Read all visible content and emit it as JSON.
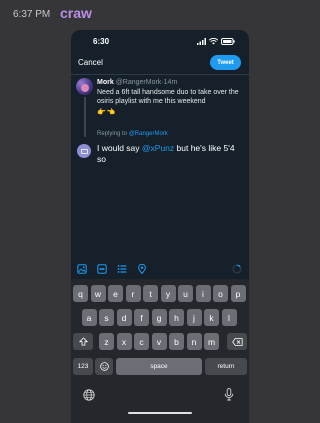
{
  "chat": {
    "time": "6:37 PM",
    "username": "craw"
  },
  "status_bar": {
    "time": "6:30"
  },
  "compose": {
    "cancel_label": "Cancel",
    "tweet_label": "Tweet"
  },
  "original_tweet": {
    "name": "Mork",
    "handle": "@RangerMork",
    "age": "14m",
    "text": "Need a 6ft tall handsome duo to take over the osiris playlist with me this weekend",
    "emoji": "👉👈"
  },
  "reply": {
    "replying_to_label": "Replying to",
    "replying_to_handle": "@RangerMork",
    "text_before": "I would say ",
    "mention": "@xPunz",
    "text_after": " but he's like 5'4 so"
  },
  "toolbar": {
    "icons": [
      "image-icon",
      "gif-icon",
      "poll-icon",
      "location-icon",
      "progress-circle-icon"
    ]
  },
  "keyboard": {
    "row1": [
      "q",
      "w",
      "e",
      "r",
      "t",
      "y",
      "u",
      "i",
      "o",
      "p"
    ],
    "row2": [
      "a",
      "s",
      "d",
      "f",
      "g",
      "h",
      "j",
      "k",
      "l"
    ],
    "row3": [
      "z",
      "x",
      "c",
      "v",
      "b",
      "n",
      "m"
    ],
    "numbers_label": "123",
    "space_label": "space",
    "return_label": "return"
  },
  "colors": {
    "accent": "#1d9bf0",
    "background": "#15202b",
    "username": "#b98fe6"
  }
}
